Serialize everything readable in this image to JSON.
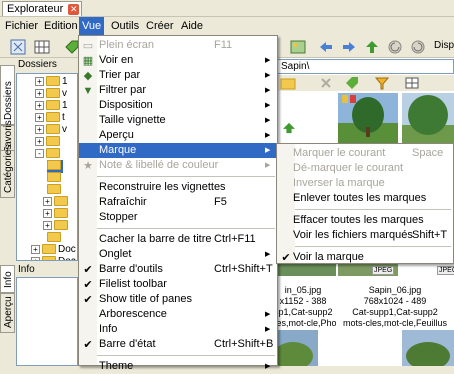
{
  "app": {
    "title": "Explorateur",
    "close_glyph": "✕"
  },
  "menubar": [
    "Fichier",
    "Edition",
    "Vue",
    "Outils",
    "Créer",
    "Aide"
  ],
  "toolbar": {
    "right_label": "Disp"
  },
  "left": {
    "tabs": [
      "Dossiers",
      "Favoris",
      "Catégories"
    ],
    "panel_title": "Dossiers",
    "info_title": "Info",
    "bottom_tabs": [
      "Info",
      "Aperçu"
    ],
    "tree": [
      {
        "label": "1",
        "exp": "+"
      },
      {
        "label": "v",
        "exp": "+"
      },
      {
        "label": "1",
        "exp": "+"
      },
      {
        "label": "t",
        "exp": "+"
      },
      {
        "label": "v",
        "exp": "+"
      },
      {
        "label": "",
        "exp": "+"
      },
      {
        "label": "",
        "exp": "-"
      },
      {
        "label": "",
        "exp": ""
      },
      {
        "label": "",
        "exp": ""
      },
      {
        "label": "",
        "exp": ""
      },
      {
        "label": "",
        "exp": "+"
      },
      {
        "label": "",
        "exp": "+"
      },
      {
        "label": "",
        "exp": "+"
      },
      {
        "label": "",
        "exp": ""
      },
      {
        "label": "Doc",
        "exp": "+"
      },
      {
        "label": "Doc",
        "exp": "+"
      }
    ]
  },
  "content": {
    "path": "Sapin\\",
    "captions": [
      {
        "name": "in_05.jpg",
        "dims": "x1152 - 388",
        "cats": "up1,Cat-supp2",
        "tags": "cles,mot-cle,Photo..."
      },
      {
        "name": "Sapin_06.jpg",
        "dims": "768x1024 - 489",
        "cats": "Cat-supp1,Cat-supp2",
        "tags": "mots-cles,mot-cle,Feuillus"
      }
    ],
    "badge": "JPEG"
  },
  "vue_menu": {
    "items": [
      {
        "label": "Plein écran",
        "shortcut": "F11",
        "disabled": true,
        "icon": "fullscreen-icon",
        "glyph": "▭"
      },
      {
        "label": "Voir en",
        "submenu": true,
        "icon": "view-as-icon",
        "glyph": "▦"
      },
      {
        "label": "Trier par",
        "submenu": true,
        "icon": "sort-icon",
        "glyph": "◆"
      },
      {
        "label": "Filtrer par",
        "submenu": true,
        "icon": "filter-icon",
        "glyph": "▼"
      },
      {
        "label": "Disposition",
        "submenu": true
      },
      {
        "label": "Taille vignette",
        "submenu": true
      },
      {
        "label": "Aperçu",
        "submenu": true
      },
      {
        "label": "Marque",
        "submenu": true,
        "highlighted": true
      },
      {
        "label": "Note & libellé de couleur",
        "submenu": true,
        "disabled": true,
        "icon": "note-icon",
        "glyph": "★"
      },
      {
        "sep": true
      },
      {
        "label": "Reconstruire les vignettes"
      },
      {
        "label": "Rafraîchir",
        "shortcut": "F5"
      },
      {
        "label": "Stopper"
      },
      {
        "sep": true
      },
      {
        "label": "Cacher la barre de titre",
        "shortcut": "Ctrl+F11"
      },
      {
        "label": "Onglet",
        "submenu": true
      },
      {
        "label": "Barre d'outils",
        "shortcut": "Ctrl+Shift+T",
        "checked": true
      },
      {
        "label": "Filelist toolbar",
        "checked": true
      },
      {
        "label": "Show title of panes",
        "checked": true
      },
      {
        "label": "Arborescence",
        "submenu": true
      },
      {
        "label": "Info",
        "submenu": true
      },
      {
        "label": "Barre d'état",
        "shortcut": "Ctrl+Shift+B",
        "checked": true
      },
      {
        "sep": true
      },
      {
        "label": "Theme",
        "submenu": true
      }
    ]
  },
  "marque_menu": {
    "items": [
      {
        "label": "Marquer le courant",
        "shortcut": "Space",
        "disabled": true
      },
      {
        "label": "Dé-marquer le courant",
        "disabled": true
      },
      {
        "label": "Inverser la marque",
        "disabled": true
      },
      {
        "label": "Enlever toutes les marques"
      },
      {
        "sep": true
      },
      {
        "label": "Effacer toutes les marques"
      },
      {
        "label": "Voir les fichiers marqués",
        "shortcut": "Shift+T"
      },
      {
        "sep": true
      },
      {
        "label": "Voir la marque",
        "checked": true
      }
    ]
  },
  "colors": {
    "highlight": "#316ac5",
    "menubar_bg": "#ece9d8",
    "tab_close": "#e0583c"
  }
}
